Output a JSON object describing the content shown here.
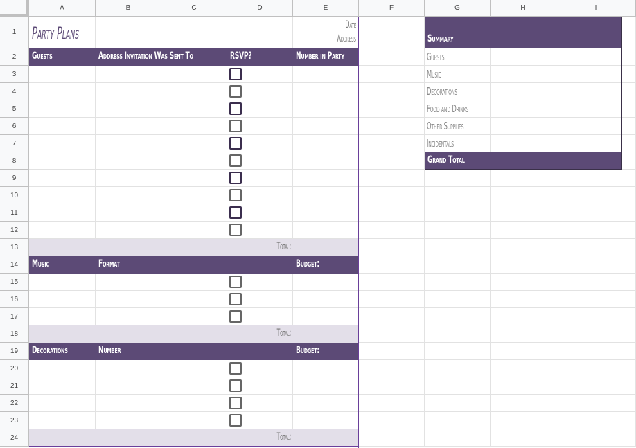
{
  "columns": [
    "A",
    "B",
    "C",
    "D",
    "E",
    "F",
    "G",
    "H",
    "I"
  ],
  "rows": [
    "1",
    "2",
    "3",
    "4",
    "5",
    "6",
    "7",
    "8",
    "9",
    "10",
    "11",
    "12",
    "13",
    "14",
    "15",
    "16",
    "17",
    "18",
    "19",
    "20",
    "21",
    "22",
    "23",
    "24"
  ],
  "sheet": {
    "title": "Party Plans",
    "date_label": "Date",
    "address_label": "Address",
    "guests_section": {
      "headers": [
        "Guests",
        "Address Invitation Was Sent To",
        "RSVP?",
        "Number in Party"
      ],
      "checkbox_rows": 10,
      "checked": [
        false,
        false,
        false,
        false,
        false,
        false,
        false,
        false,
        false,
        false
      ],
      "total_label": "Total:"
    },
    "music_section": {
      "headers": [
        "Music",
        "Format",
        "Budget:"
      ],
      "checkbox_rows": 3,
      "checked": [
        false,
        false,
        false
      ],
      "total_label": "Total:"
    },
    "decorations_section": {
      "headers": [
        "Decorations",
        "Number",
        "Budget:"
      ],
      "checkbox_rows": 4,
      "checked": [
        false,
        false,
        false,
        false
      ],
      "total_label": "Total:"
    },
    "summary": {
      "title": "Summary",
      "items": [
        "Guests",
        "Music",
        "Decorations",
        "Food and Drinks",
        "Other Supplies",
        "Incidentals"
      ],
      "grand_total_label": "Grand Total"
    }
  },
  "colors": {
    "header_purple": "#5c4a76",
    "total_band": "#e3dfe9",
    "checkbox_dark": "#3b2e4e",
    "checkbox_grey": "#666666"
  }
}
